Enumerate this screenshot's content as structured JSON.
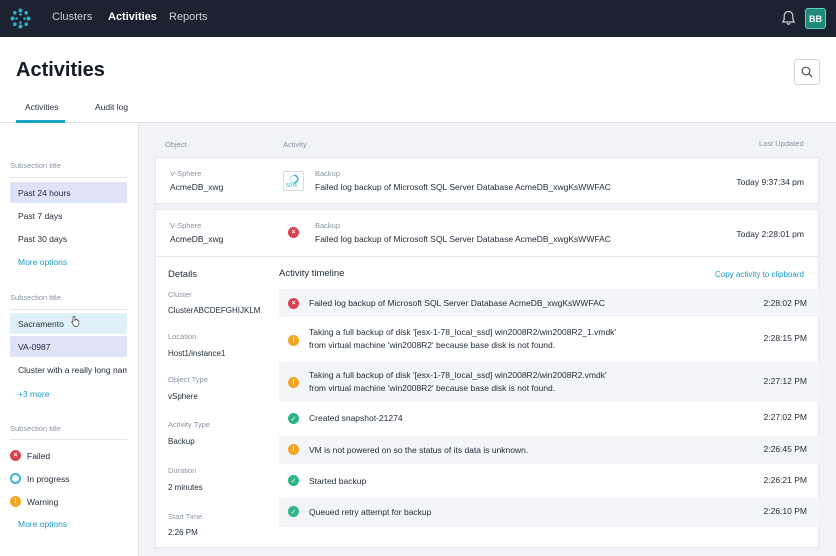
{
  "nav": {
    "items": [
      "Clusters",
      "Activities",
      "Reports"
    ],
    "active": "Activities",
    "avatar": "BB"
  },
  "header": {
    "title": "Activities",
    "tabs": [
      "Activities",
      "Audit log"
    ]
  },
  "sidebar": {
    "group1": {
      "title": "Subsection title",
      "items": [
        "Past 24 hours",
        "Past 7 days",
        "Past 30 days"
      ],
      "more": "More options"
    },
    "group2": {
      "title": "Subsection title",
      "items": [
        "Sacramento",
        "VA-0987",
        "Cluster with a really long name"
      ],
      "more": "+3 more"
    },
    "group3": {
      "title": "Subsection title",
      "items": [
        "Failed",
        "In progress",
        "Warning"
      ],
      "more": "More options"
    }
  },
  "columns": {
    "object": "Object",
    "activity": "Activity",
    "updated": "Last Updated"
  },
  "rows": [
    {
      "obj_type": "V-Sphere",
      "obj_name": "AcmeDB_xwg",
      "act_type": "Backup",
      "act_text": "Failed log backup of Microsoft SQL Server Database AcmeDB_xwgKsWWFAC",
      "progress": "50%",
      "time": "Today 9:37:34 pm"
    },
    {
      "obj_type": "V-Sphere",
      "obj_name": "AcmeDB_xwg",
      "act_type": "Backup",
      "act_text": "Failed log backup of Microsoft SQL Server Database AcmeDB_xwgKsWWFAC",
      "time": "Today 2:28:01 pm"
    }
  ],
  "details": {
    "title": "Details",
    "fields": [
      {
        "label": "Cluster",
        "value": "ClusterABCDEFGHIJKLM"
      },
      {
        "label": "Location",
        "value": "Host1/instance1"
      },
      {
        "label": "Object Type",
        "value": "vSphere"
      },
      {
        "label": "Activity Type",
        "value": "Backup"
      },
      {
        "label": "Duration",
        "value": "2 minutes"
      },
      {
        "label": "Start Time",
        "value": "2:26 PM"
      }
    ]
  },
  "timeline": {
    "title": "Activity timeline",
    "copy": "Copy activity to clipboard",
    "events": [
      {
        "status": "failed",
        "line1": "Failed log backup of Microsoft SQL Server Database AcmeDB_xwgKsWWFAC",
        "line2": "",
        "time": "2:28:02 PM"
      },
      {
        "status": "warning",
        "line1": "Taking a full backup of disk '[esx-1-78_local_ssd] win2008R2/win2008R2_1.vmdk'",
        "line2": "from virtual machine 'win2008R2' because base disk is not found.",
        "time": "2:28:15 PM"
      },
      {
        "status": "warning",
        "line1": "Taking a full backup of disk '[esx-1-78_local_ssd] win2008R2/win2008R2.vmdk'",
        "line2": "from virtual machine 'win2008R2' because base disk is not found.",
        "time": "2:27:12 PM"
      },
      {
        "status": "success",
        "line1": "Created snapshot-21274",
        "line2": "",
        "time": "2:27:02 PM"
      },
      {
        "status": "warning",
        "line1": "VM is not powered on so the status of its data is unknown.",
        "line2": "",
        "time": "2:26:45 PM"
      },
      {
        "status": "success",
        "line1": "Started backup",
        "line2": "",
        "time": "2:26:21 PM"
      },
      {
        "status": "success",
        "line1": "Queued retry attempt for backup",
        "line2": "",
        "time": "2:26:10 PM"
      }
    ]
  },
  "icons": {
    "logo": "cluster-logo-icon",
    "bell": "bell-icon",
    "search": "search-icon",
    "failed": "x-circle-icon",
    "warning": "exclamation-circle-icon",
    "success": "check-circle-icon",
    "in_progress": "progress-ring-icon"
  },
  "colors": {
    "topbar": "#1d2230",
    "accent": "#1aa6c4",
    "failed": "#d9414e",
    "warning": "#f2a623",
    "success": "#2fb585",
    "progress": "#39b3d6"
  }
}
